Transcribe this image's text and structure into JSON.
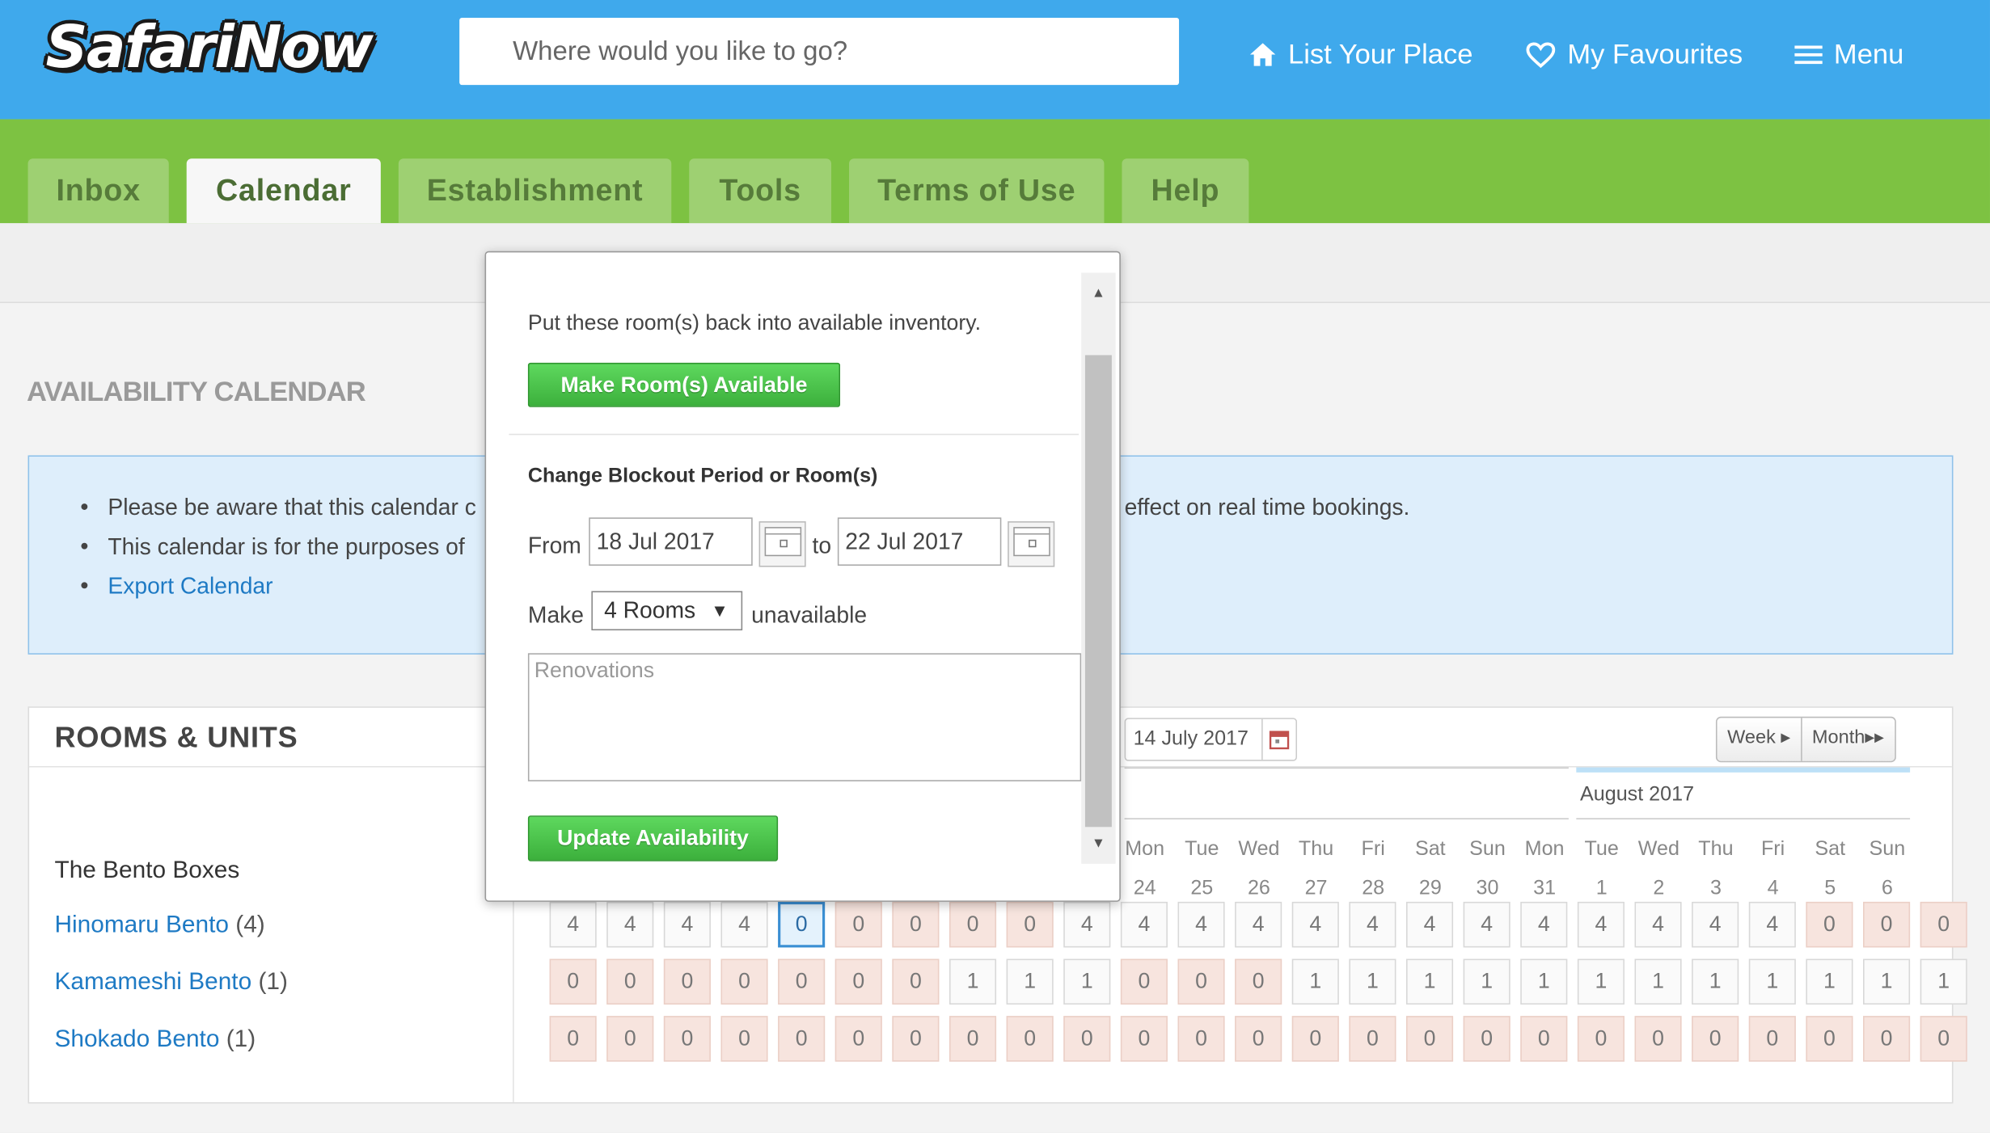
{
  "header": {
    "logo": "SafariNow",
    "search_placeholder": "Where would you like to go?",
    "list_place": "List Your Place",
    "favourites": "My Favourites",
    "menu": "Menu",
    "colors": {
      "header_bg": "#3fa9ec",
      "tabbar_bg": "#7dc242"
    }
  },
  "tabs": [
    "Inbox",
    "Calendar",
    "Establishment",
    "Tools",
    "Terms of Use",
    "Help"
  ],
  "active_tab": "Calendar",
  "page": {
    "title": "AVAILABILITY CALENDAR",
    "info": [
      "Please be aware that this calendar c",
      "This calendar is for the purposes of",
      "effect on real time bookings."
    ],
    "export_link": "Export Calendar"
  },
  "rooms_panel": {
    "title": "ROOMS & UNITS",
    "group": "The Bento Boxes",
    "rooms": [
      {
        "name": "Hinomaru Bento",
        "count": "(4)"
      },
      {
        "name": "Kamameshi Bento",
        "count": "(1)"
      },
      {
        "name": "Shokado Bento",
        "count": "(1)"
      }
    ],
    "date": "14 July 2017",
    "view_week": "Week",
    "view_month": "Month",
    "month_label": "August 2017",
    "days": [
      {
        "dow": "Mon",
        "num": "24"
      },
      {
        "dow": "Tue",
        "num": "25"
      },
      {
        "dow": "Wed",
        "num": "26"
      },
      {
        "dow": "Thu",
        "num": "27"
      },
      {
        "dow": "Fri",
        "num": "28"
      },
      {
        "dow": "Sat",
        "num": "29"
      },
      {
        "dow": "Sun",
        "num": "30"
      },
      {
        "dow": "Mon",
        "num": "31"
      },
      {
        "dow": "Tue",
        "num": "1"
      },
      {
        "dow": "Wed",
        "num": "2"
      },
      {
        "dow": "Thu",
        "num": "3"
      },
      {
        "dow": "Fri",
        "num": "4"
      },
      {
        "dow": "Sat",
        "num": "5"
      },
      {
        "dow": "Sun",
        "num": "6"
      }
    ],
    "availability": [
      [
        "4",
        "4",
        "4",
        "4",
        "0",
        "0",
        "0",
        "0",
        "0",
        "4",
        "4",
        "4",
        "4",
        "4",
        "4",
        "4",
        "4",
        "4",
        "4",
        "4",
        "4",
        "4",
        "0",
        "0",
        "0"
      ],
      [
        "0",
        "0",
        "0",
        "0",
        "0",
        "0",
        "0",
        "1",
        "1",
        "1",
        "0",
        "0",
        "0",
        "1",
        "1",
        "1",
        "1",
        "1",
        "1",
        "1",
        "1",
        "1",
        "1",
        "1",
        "1"
      ],
      [
        "0",
        "0",
        "0",
        "0",
        "0",
        "0",
        "0",
        "0",
        "0",
        "0",
        "0",
        "0",
        "0",
        "0",
        "0",
        "0",
        "0",
        "0",
        "0",
        "0",
        "0",
        "0",
        "0",
        "0",
        "0"
      ]
    ]
  },
  "popup": {
    "intro": "Put these room(s) back into available inventory.",
    "make_available_btn": "Make Room(s) Available",
    "change_heading": "Change Blockout Period or Room(s)",
    "from_label": "From",
    "from_value": "18 Jul 2017",
    "to_label": "to",
    "to_value": "22 Jul 2017",
    "make_label": "Make",
    "rooms_select": "4 Rooms",
    "unavailable_label": "unavailable",
    "reason_placeholder": "Renovations",
    "update_btn": "Update Availability"
  }
}
